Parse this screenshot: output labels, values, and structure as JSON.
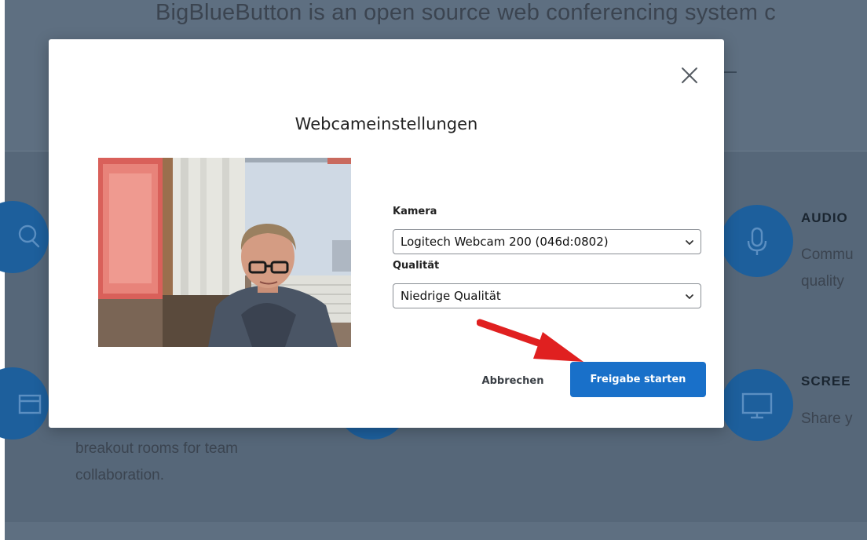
{
  "background": {
    "intro": "BigBlueButton is an open source web conferencing system c",
    "features": {
      "audio_title": "AUDIO",
      "audio_line1": "Commu",
      "audio_line2": "quality",
      "screen_title": "SCREE",
      "screen_line1": "Share y",
      "breakout_line1": "breakout rooms for team",
      "breakout_line2": "collaboration."
    }
  },
  "modal": {
    "title": "Webcameinstellungen",
    "camera_label": "Kamera",
    "camera_value": "Logitech Webcam 200 (046d:0802)",
    "quality_label": "Qualität",
    "quality_value": "Niedrige Qualität",
    "cancel_label": "Abbrechen",
    "start_label": "Freigabe starten"
  },
  "icons": {
    "close": "close-icon",
    "chevron": "chevron-down-icon",
    "chat": "chat-icon",
    "breakout": "breakout-icon",
    "microphone": "microphone-icon",
    "monitor": "monitor-icon",
    "annotation": "red-arrow"
  },
  "colors": {
    "primary_button": "#1970c9",
    "feature_circle": "#1d5f9c",
    "overlay_bg": "#5a6b7d",
    "annotation_arrow": "#e02020"
  }
}
